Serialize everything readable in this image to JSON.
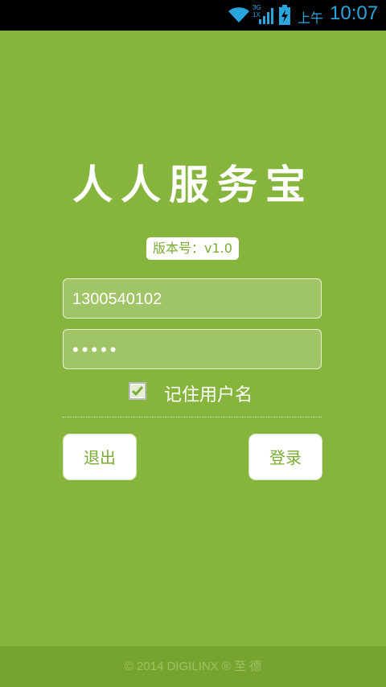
{
  "status_bar": {
    "network": "3G",
    "network_sub": "1X",
    "ampm": "上午",
    "time": "10:07",
    "accent_color": "#2aa6de",
    "icons": [
      "wifi-icon",
      "signal-icon",
      "battery-charging-icon"
    ]
  },
  "app": {
    "title": "人人服务宝",
    "version": "版本号：v1.0",
    "brand_color": "#85b53c"
  },
  "login_form": {
    "username_value": "1300540102",
    "password_masked": "•••••",
    "remember_label": "记住用户名",
    "remember_checked": true,
    "exit_label": "退出",
    "login_label": "登录"
  },
  "footer": {
    "copyright": "© 2014 DIGILINX ® 至 德"
  }
}
